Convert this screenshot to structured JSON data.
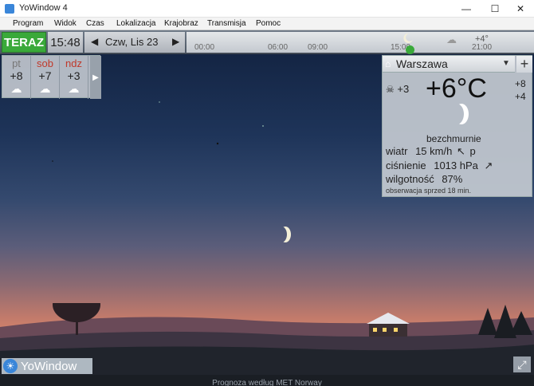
{
  "window": {
    "title": "YoWindow 4"
  },
  "menu": [
    "Program",
    "Widok",
    "Czas",
    "Lokalizacja",
    "Krajobraz",
    "Transmisja",
    "Pomoc"
  ],
  "toolbar": {
    "now_label": "TERAZ",
    "time": "15:48",
    "date": "Czw, Lis 23",
    "timeline_ticks": [
      "00:00",
      "06:00",
      "09:00",
      "15:00",
      "21:00"
    ],
    "forecast_temp": "+4°"
  },
  "forecast": [
    {
      "day": "pt",
      "temp": "+8",
      "day_color": "#777777"
    },
    {
      "day": "sob",
      "temp": "+7",
      "day_color": "#c0392b"
    },
    {
      "day": "ndz",
      "temp": "+3",
      "day_color": "#c0392b"
    }
  ],
  "current": {
    "location": "Warszawa",
    "feels_like": "+3",
    "temperature": "+6°C",
    "high": "+8",
    "low": "+4",
    "condition": "bezchmurnie",
    "wind_label": "wiatr",
    "wind_value": "15 km/h",
    "wind_dir": "p",
    "pressure_label": "ciśnienie",
    "pressure_value": "1013 hPa",
    "humidity_label": "wilgotność",
    "humidity_value": "87%",
    "observation": "obserwacja sprzed 18 min."
  },
  "brand": "YoWindow",
  "footer": "Prognoza według MET Norway",
  "colors": {
    "now_green": "#3aa93a",
    "weekend_red": "#c0392b"
  }
}
